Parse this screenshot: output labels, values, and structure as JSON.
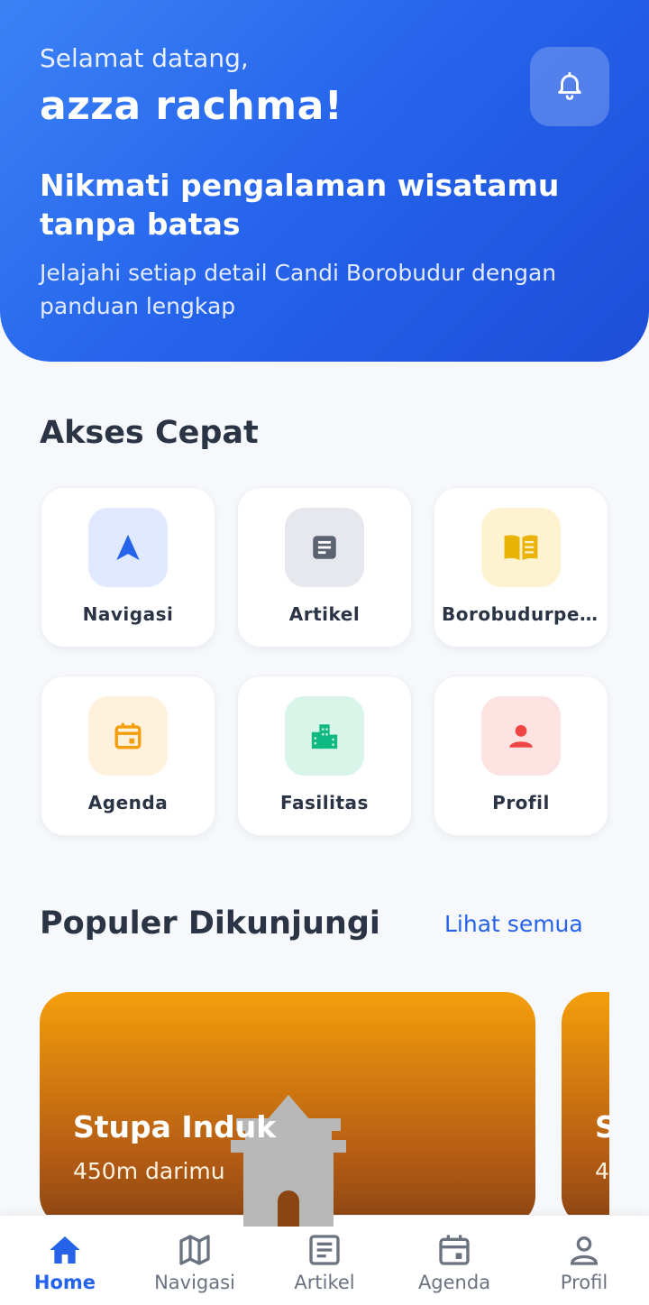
{
  "header": {
    "greeting": "Selamat datang,",
    "user_name": "azza rachma!",
    "headline": "Nikmati pengalaman wisatamu tanpa batas",
    "subline": "Jelajahi setiap detail Candi Borobudur dengan panduan lengkap",
    "bell_icon": "bell-icon"
  },
  "quick_access": {
    "title": "Akses Cepat",
    "items": [
      {
        "label": "Navigasi",
        "icon": "navigation-arrow-icon",
        "icon_color": "#2563eb",
        "bg": "#e0e9ff"
      },
      {
        "label": "Artikel",
        "icon": "article-icon",
        "icon_color": "#5b6270",
        "bg": "#e6e8ee"
      },
      {
        "label": "Borobudurpedia",
        "icon": "book-icon",
        "icon_color": "#eab308",
        "bg": "#fdf3d0"
      },
      {
        "label": "Agenda",
        "icon": "calendar-icon",
        "icon_color": "#f59e0b",
        "bg": "#fff1dc"
      },
      {
        "label": "Fasilitas",
        "icon": "building-icon",
        "icon_color": "#10b981",
        "bg": "#d9f5ea"
      },
      {
        "label": "Profil",
        "icon": "person-icon",
        "icon_color": "#ef4444",
        "bg": "#fde2e2"
      }
    ]
  },
  "popular": {
    "title": "Populer Dikunjungi",
    "see_all": "Lihat semua",
    "places": [
      {
        "name": "Stupa Induk",
        "distance": "450m darimu"
      },
      {
        "name": "S",
        "distance": "4"
      }
    ]
  },
  "bottom_nav": {
    "active": "Home",
    "items": [
      {
        "label": "Home",
        "icon": "home-icon"
      },
      {
        "label": "Navigasi",
        "icon": "map-icon"
      },
      {
        "label": "Artikel",
        "icon": "article-icon"
      },
      {
        "label": "Agenda",
        "icon": "calendar-icon"
      },
      {
        "label": "Profil",
        "icon": "person-icon"
      }
    ]
  },
  "colors": {
    "primary": "#2563eb",
    "header_gradient_start": "#3b82f6",
    "header_gradient_end": "#1d4ed8",
    "card_gradient_start": "#f59e0b",
    "card_gradient_end": "#8b4513"
  }
}
